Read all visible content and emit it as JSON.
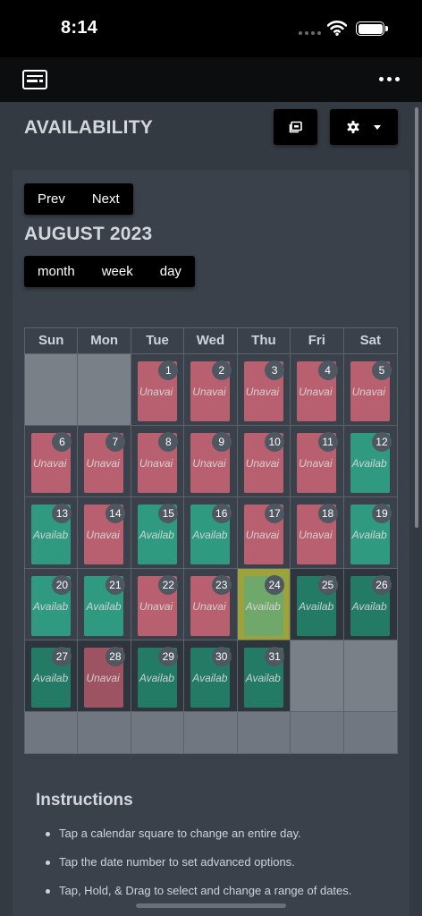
{
  "status": {
    "time": "8:14"
  },
  "header": {
    "title": "AVAILABILITY"
  },
  "calendar": {
    "title": "AUGUST 2023",
    "prev_label": "Prev",
    "next_label": "Next",
    "views": [
      "month",
      "week",
      "day"
    ],
    "weekdays": [
      "Sun",
      "Mon",
      "Tue",
      "Wed",
      "Thu",
      "Fri",
      "Sat"
    ],
    "first_weekday_index": 2,
    "unavailable_label": "Unavai",
    "available_label": "Availab",
    "days": [
      {
        "day": 1,
        "status": "unavailable"
      },
      {
        "day": 2,
        "status": "unavailable"
      },
      {
        "day": 3,
        "status": "unavailable"
      },
      {
        "day": 4,
        "status": "unavailable"
      },
      {
        "day": 5,
        "status": "unavailable"
      },
      {
        "day": 6,
        "status": "unavailable"
      },
      {
        "day": 7,
        "status": "unavailable"
      },
      {
        "day": 8,
        "status": "unavailable"
      },
      {
        "day": 9,
        "status": "unavailable"
      },
      {
        "day": 10,
        "status": "unavailable"
      },
      {
        "day": 11,
        "status": "unavailable"
      },
      {
        "day": 12,
        "status": "available"
      },
      {
        "day": 13,
        "status": "available"
      },
      {
        "day": 14,
        "status": "unavailable"
      },
      {
        "day": 15,
        "status": "available"
      },
      {
        "day": 16,
        "status": "available"
      },
      {
        "day": 17,
        "status": "unavailable"
      },
      {
        "day": 18,
        "status": "unavailable"
      },
      {
        "day": 19,
        "status": "available"
      },
      {
        "day": 20,
        "status": "available"
      },
      {
        "day": 21,
        "status": "available"
      },
      {
        "day": 22,
        "status": "unavailable"
      },
      {
        "day": 23,
        "status": "unavailable"
      },
      {
        "day": 24,
        "status": "available",
        "today": true
      },
      {
        "day": 25,
        "status": "available",
        "shaded": true
      },
      {
        "day": 26,
        "status": "available",
        "shaded": true
      },
      {
        "day": 27,
        "status": "available",
        "shaded": true
      },
      {
        "day": 28,
        "status": "unavailable",
        "shaded": true
      },
      {
        "day": 29,
        "status": "available",
        "shaded": true
      },
      {
        "day": 30,
        "status": "available",
        "shaded": true
      },
      {
        "day": 31,
        "status": "available",
        "shaded": true
      }
    ]
  },
  "instructions": {
    "title": "Instructions",
    "items": [
      "Tap a calendar square to change an entire day.",
      "Tap the date number to set advanced options.",
      "Tap, Hold, & Drag to select and change a range of dates."
    ]
  },
  "colors": {
    "unavailable": "#b86070",
    "available": "#2f9a80",
    "today": "#9ea23a",
    "background": "#343a42"
  }
}
